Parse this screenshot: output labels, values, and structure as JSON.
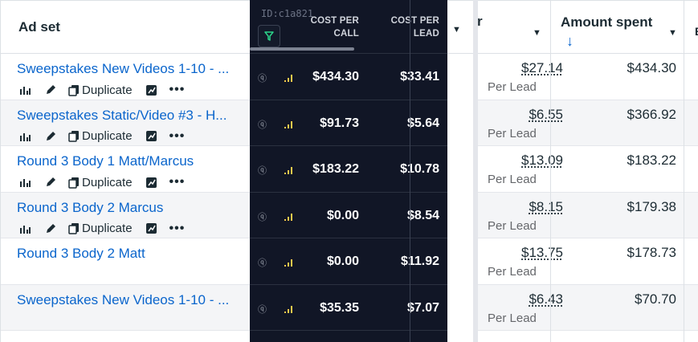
{
  "header": {
    "adset_label": "Ad set",
    "overlay_id": "ID:c1a821",
    "cost_per_call": "COST PER CALL",
    "cost_per_lead": "COST PER LEAD",
    "partial_col": "r",
    "amount_spent": "Amount spent",
    "sort_arrow": "↓",
    "edge_letter": "E"
  },
  "actions": {
    "duplicate_label": "Duplicate",
    "more_label": "•••"
  },
  "rows": [
    {
      "name": "Sweepstakes New Videos 1-10 - ...",
      "has_actions": true,
      "cost_call": "$434.30",
      "cost_lead": "$33.41",
      "cpl": "$27.14",
      "per": "Per Lead",
      "amount": "$434.30"
    },
    {
      "name": "Sweepstakes Static/Video #3 - H...",
      "has_actions": true,
      "cost_call": "$91.73",
      "cost_lead": "$5.64",
      "cpl": "$6.55",
      "per": "Per Lead",
      "amount": "$366.92"
    },
    {
      "name": "Round 3 Body 1 Matt/Marcus",
      "has_actions": true,
      "cost_call": "$183.22",
      "cost_lead": "$10.78",
      "cpl": "$13.09",
      "per": "Per Lead",
      "amount": "$183.22"
    },
    {
      "name": "Round 3 Body 2 Marcus",
      "has_actions": true,
      "cost_call": "$0.00",
      "cost_lead": "$8.54",
      "cpl": "$8.15",
      "per": "Per Lead",
      "amount": "$179.38"
    },
    {
      "name": "Round 3 Body 2 Matt",
      "has_actions": false,
      "cost_call": "$0.00",
      "cost_lead": "$11.92",
      "cpl": "$13.75",
      "per": "Per Lead",
      "amount": "$178.73"
    },
    {
      "name": "Sweepstakes New Videos 1-10 - ...",
      "has_actions": false,
      "cost_call": "$35.35",
      "cost_lead": "$7.07",
      "cpl": "$6.43",
      "per": "Per Lead",
      "amount": "$70.70"
    }
  ]
}
